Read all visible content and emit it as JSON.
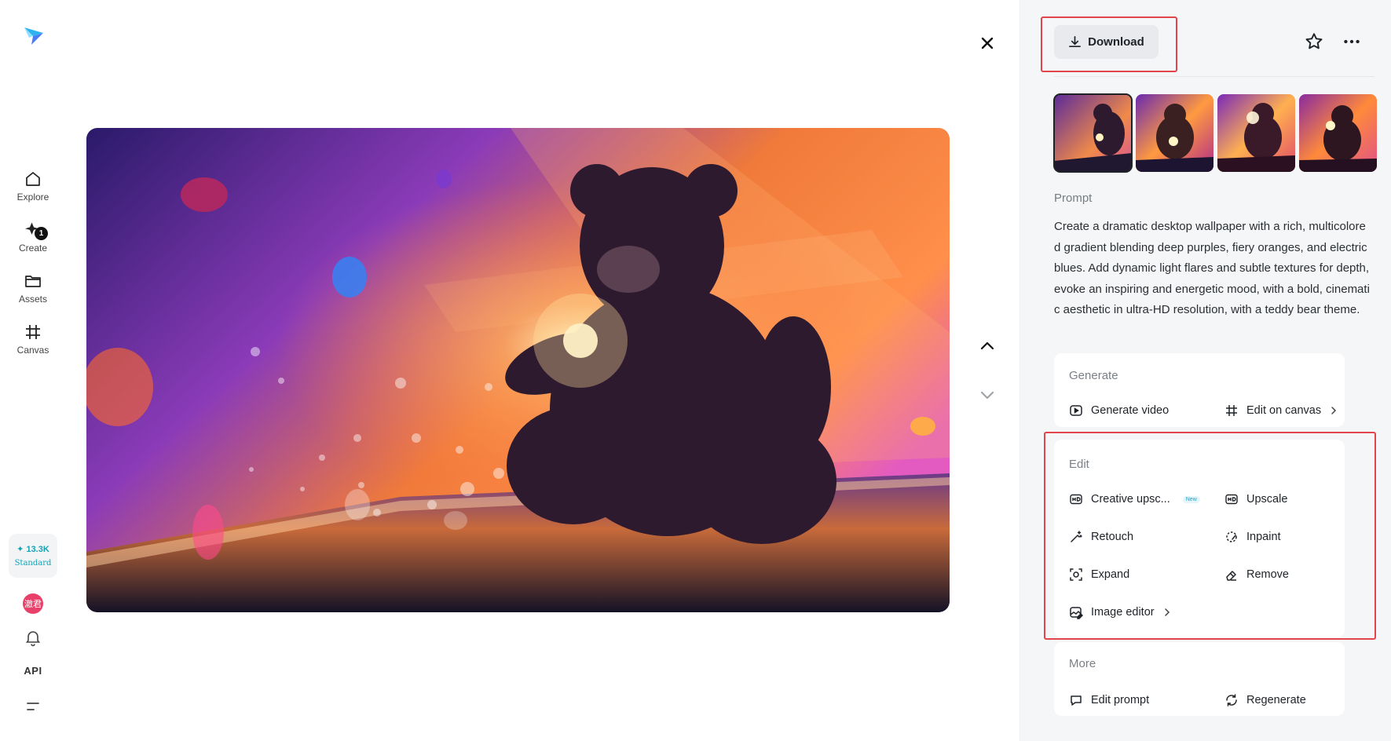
{
  "nav": {
    "items": [
      {
        "label": "Explore",
        "icon": "home-icon"
      },
      {
        "label": "Create",
        "icon": "create-icon",
        "badge": "1"
      },
      {
        "label": "Assets",
        "icon": "folder-icon"
      },
      {
        "label": "Canvas",
        "icon": "canvas-icon"
      }
    ],
    "credits": {
      "amount": "✦ 13.3K",
      "plan": "Standard"
    },
    "avatar_text": "澈君",
    "api_label": "API"
  },
  "toolbar": {
    "download_label": "Download"
  },
  "prompt": {
    "label": "Prompt",
    "text": "Create a dramatic desktop wallpaper with a rich, multicolored gradient blending deep purples, fiery oranges, and electric blues. Add dynamic light flares and subtle textures for depth, evoke an inspiring and energetic mood, with a bold, cinematic aesthetic in ultra-HD resolution, with a teddy bear theme."
  },
  "sections": {
    "generate": {
      "title": "Generate",
      "actions": [
        "Generate video",
        "Edit on canvas"
      ]
    },
    "edit": {
      "title": "Edit",
      "new_badge": "New",
      "actions": [
        "Creative upsc...",
        "Upscale",
        "Retouch",
        "Inpaint",
        "Expand",
        "Remove",
        "Image editor"
      ]
    },
    "more": {
      "title": "More",
      "actions": [
        "Edit prompt",
        "Regenerate"
      ]
    }
  },
  "colors": {
    "highlight": "#e2454b",
    "accent": "#13a3b5",
    "panel_bg": "#f5f6f7"
  }
}
